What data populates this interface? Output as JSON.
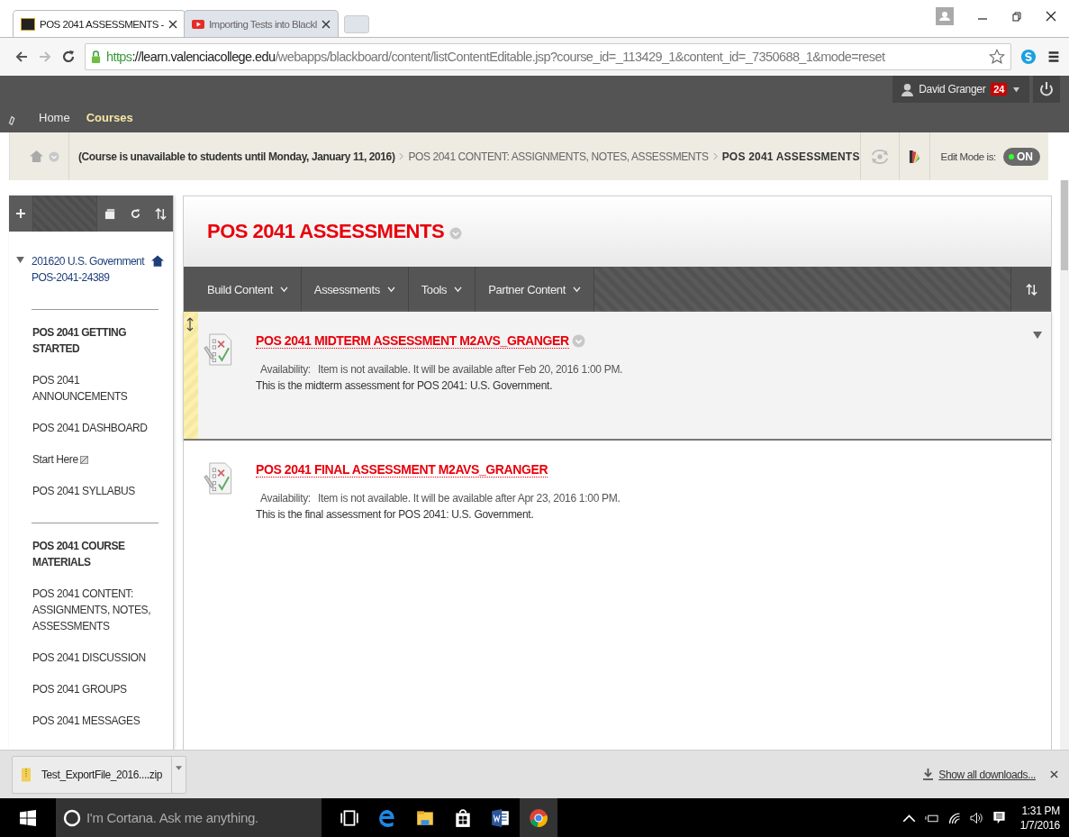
{
  "browser": {
    "tabs": [
      {
        "title": "POS 2041 ASSESSMENTS -",
        "kind": "bb",
        "selected": true
      },
      {
        "title": "Importing Tests into Blackl",
        "kind": "video",
        "selected": false
      }
    ],
    "url": {
      "scheme": "https",
      "rest_host": "://learn.valenciacollege.edu",
      "path": "/webapps/blackboard/content/listContentEditable.jsp?course_id=_113429_1&content_id=_7350688_1&mode=reset"
    }
  },
  "bb": {
    "nav": [
      {
        "label": "Home",
        "selected": false
      },
      {
        "label": "Courses",
        "selected": true
      }
    ],
    "user": {
      "name": "David Granger",
      "badge": "24"
    },
    "breadcrumbs": {
      "notice": "(Course is unavailable to students until Monday, January 11, 2016)",
      "items": [
        {
          "label": "POS 2041 CONTENT: ASSIGNMENTS, NOTES, ASSESSMENTS",
          "current": false
        },
        {
          "label": "POS 2041 ASSESSMENTS",
          "current": true
        }
      ]
    },
    "edit_mode": {
      "label": "Edit Mode is:",
      "state": "ON",
      "on": true
    }
  },
  "sidebar": {
    "course": {
      "title": "201620 U.S. Government",
      "code": "POS-2041-24389"
    },
    "sections": [
      [
        {
          "label": "POS 2041 GETTING STARTED",
          "kind": "heading"
        },
        {
          "label": "POS 2041 ANNOUNCEMENTS",
          "kind": "link"
        },
        {
          "label": "POS 2041 DASHBOARD",
          "kind": "link"
        },
        {
          "label": "Start Here",
          "kind": "hidden-link"
        },
        {
          "label": "POS 2041 SYLLABUS",
          "kind": "link"
        }
      ],
      [
        {
          "label": "POS 2041 COURSE MATERIALS",
          "kind": "heading"
        },
        {
          "label": "POS 2041 CONTENT: ASSIGNMENTS, NOTES, ASSESSMENTS",
          "kind": "link"
        },
        {
          "label": "POS 2041 DISCUSSION",
          "kind": "link"
        },
        {
          "label": "POS 2041 GROUPS",
          "kind": "link"
        },
        {
          "label": "POS 2041 MESSAGES",
          "kind": "link"
        }
      ]
    ]
  },
  "content": {
    "title": "POS 2041 ASSESSMENTS",
    "menu": [
      "Build Content",
      "Assessments",
      "Tools",
      "Partner Content"
    ],
    "items": [
      {
        "title": "POS 2041 MIDTERM ASSESSMENT M2AVS_GRANGER",
        "availability_label": "Availability:",
        "availability": "Item is not available. It will be available after Feb 20, 2016 1:00 PM.",
        "description": "This is the midterm assessment for POS 2041: U.S. Government.",
        "selected": true
      },
      {
        "title": "POS 2041 FINAL ASSESSMENT M2AVS_GRANGER",
        "availability_label": "Availability:",
        "availability": "Item is not available. It will be available after Apr 23, 2016 1:00 PM.",
        "description": "This is the final assessment for POS 2041: U.S. Government.",
        "selected": false
      }
    ]
  },
  "downloads": {
    "file": "Test_ExportFile_2016....zip",
    "show_all": "Show all downloads..."
  },
  "taskbar": {
    "search_placeholder": "I'm Cortana. Ask me anything.",
    "time": "1:31 PM",
    "date": "1/7/2016"
  }
}
